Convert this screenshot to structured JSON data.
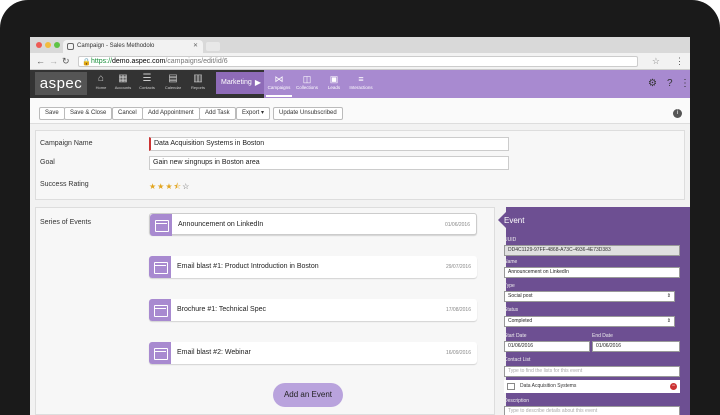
{
  "browser": {
    "tab_title": "Campaign - Sales Methodolo",
    "url_scheme": "https://",
    "url_host": "demo.aspec.com",
    "url_path": "/campaigns/edit/id/6"
  },
  "app": {
    "logo": "aspec",
    "nav": [
      {
        "label": "Home",
        "icon": "home-icon"
      },
      {
        "label": "Accounts",
        "icon": "building-icon"
      },
      {
        "label": "Contacts",
        "icon": "contacts-icon"
      },
      {
        "label": "Calendar",
        "icon": "calendar-icon"
      },
      {
        "label": "Reports",
        "icon": "reports-icon"
      }
    ],
    "module": "Marketing",
    "subnav": [
      {
        "label": "Campaigns",
        "icon": "campaigns-icon",
        "active": true
      },
      {
        "label": "Collections",
        "icon": "collections-icon",
        "active": false
      },
      {
        "label": "Leads",
        "icon": "leads-icon",
        "active": false
      },
      {
        "label": "Interactions",
        "icon": "interactions-icon",
        "active": false
      }
    ]
  },
  "toolbar": {
    "buttons": [
      "Save",
      "Save & Close",
      "Cancel",
      "Add Appointment",
      "Add Task",
      "Export ▾",
      "Update Unsubscribed"
    ]
  },
  "form": {
    "campaign_name_label": "Campaign Name",
    "campaign_name_value": "Data Acquisition Systems in Boston",
    "goal_label": "Goal",
    "goal_value": "Gain new singnups in Boston area",
    "rating_label": "Success Rating",
    "rating": 3.5,
    "rating_max": 5
  },
  "events": {
    "label": "Series of Events",
    "items": [
      {
        "title": "Announcement on LinkedIn",
        "date": "01/06/2016",
        "selected": true
      },
      {
        "title": "Email blast #1: Product Introduction in Boston",
        "date": "29/07/2016",
        "selected": false
      },
      {
        "title": "Brochure #1: Technical Spec",
        "date": "17/08/2016",
        "selected": false
      },
      {
        "title": "Email blast #2: Webinar",
        "date": "16/09/2016",
        "selected": false
      }
    ],
    "add_button": "Add an Event"
  },
  "event_panel": {
    "title": "Event",
    "uuid_label": "UUID",
    "uuid_value": "DD4C1129-97FF-4868-A73C-4936-4E73D383",
    "name_label": "Name",
    "name_value": "Announcement on LinkedIn",
    "type_label": "Type",
    "type_value": "Social post",
    "status_label": "Status",
    "status_value": "Completed",
    "start_label": "Start Date",
    "start_value": "01/06/2016",
    "end_label": "End Date",
    "end_value": "01/06/2016",
    "contact_label": "Contact List",
    "contact_placeholder": "Type to find the lists for this event",
    "contact_item": "Data Acquisition Systems",
    "description_label": "Description",
    "description_placeholder": "Type to describe details about this event"
  },
  "colors": {
    "purple_dark": "#6d4f92",
    "purple_light": "#a88ad0",
    "star": "#e2a520"
  }
}
